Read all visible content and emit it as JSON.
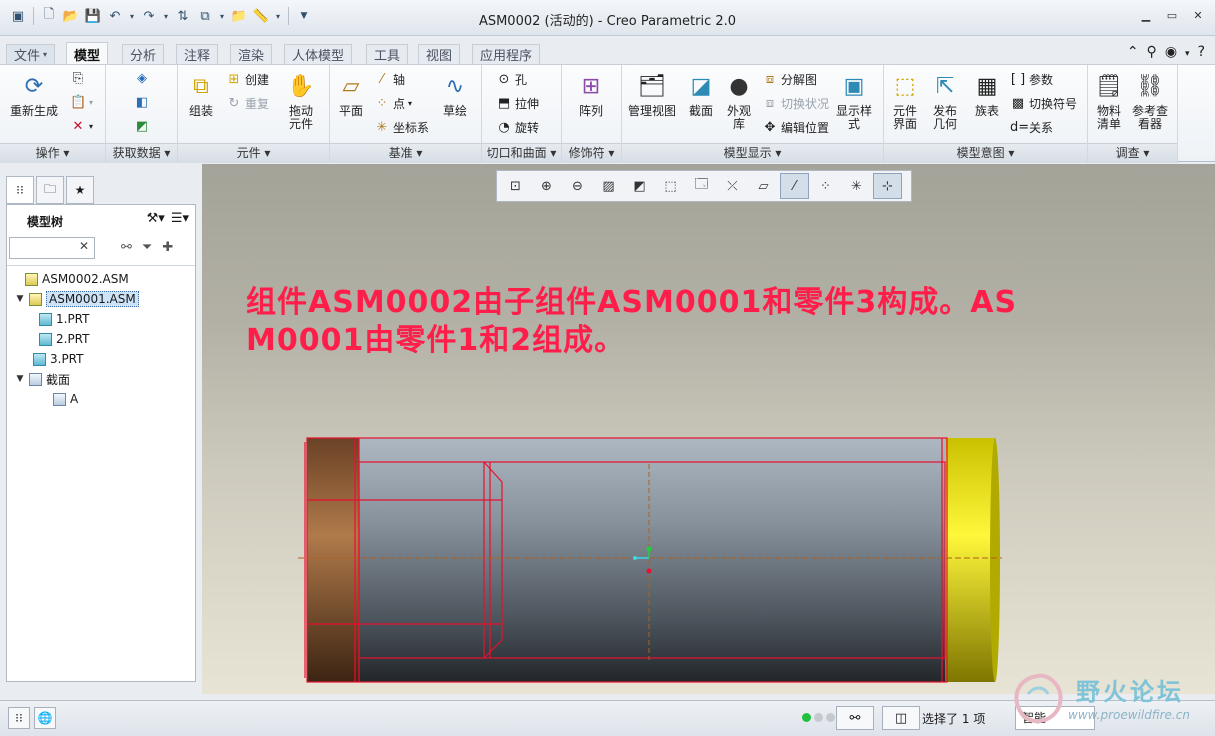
{
  "window": {
    "title": "ASM0002 (活动的) - Creo Parametric 2.0"
  },
  "tabs": [
    "文件",
    "模型",
    "分析",
    "注释",
    "渲染",
    "人体模型",
    "工具",
    "视图",
    "应用程序"
  ],
  "ribbon": {
    "groups": {
      "operations": "操作",
      "get_data": "获取数据",
      "component": "元件",
      "datum": "基准",
      "cut_surface": "切口和曲面",
      "modifiers": "修饰符",
      "model_display": "模型显示",
      "model_intent": "模型意图",
      "investigate": "调查"
    },
    "buttons": {
      "regenerate": "重新生成",
      "assemble": "组装",
      "create": "创建",
      "repeat": "重复",
      "drag_component_1": "拖动",
      "drag_component_2": "元件",
      "plane": "平面",
      "axis": "轴",
      "point": "点",
      "csys": "坐标系",
      "sketch": "草绘",
      "hole": "孔",
      "extrude": "拉伸",
      "revolve": "旋转",
      "pattern": "阵列",
      "manage_views": "管理视图",
      "section": "截面",
      "appearance_1": "外观",
      "appearance_2": "库",
      "explode_view": "分解图",
      "toggle_status": "切换状况",
      "edit_position": "编辑位置",
      "display_style_1": "显示样",
      "display_style_2": "式",
      "component_interface_1": "元件",
      "component_interface_2": "界面",
      "publish_geom_1": "发布",
      "publish_geom_2": "几何",
      "family_table": "族表",
      "parameters": "参数",
      "switch_symbols": "切换符号",
      "relations": "关系",
      "bom_1": "物料",
      "bom_2": "清单",
      "ref_viewer_1": "参考查",
      "ref_viewer_2": "看器"
    }
  },
  "model_tree": {
    "title": "模型树",
    "items": [
      {
        "label": "ASM0002.ASM",
        "level": 0
      },
      {
        "label": "ASM0001.ASM",
        "level": 1
      },
      {
        "label": "1.PRT",
        "level": 2
      },
      {
        "label": "2.PRT",
        "level": 2
      },
      {
        "label": "3.PRT",
        "level": 1
      },
      {
        "label": "截面",
        "level": 1
      },
      {
        "label": "A",
        "level": 2
      }
    ]
  },
  "annotation": {
    "line1": "组件ASM0002由子组件ASM0001和零件3构成。AS",
    "line2": "M0001由零件1和2组成。"
  },
  "status": {
    "selected_prefix": "选择了",
    "selected_count": "1",
    "selected_suffix": "项",
    "filter": "智能"
  },
  "watermark": {
    "name": "野火论坛",
    "url": "www.proewildfire.cn"
  },
  "colors": {
    "annotation": "#ff1e4a",
    "outline": "#e8102e",
    "part3": "#e6dc00",
    "part1": "#8a5a34",
    "part2": "#7a838d"
  }
}
